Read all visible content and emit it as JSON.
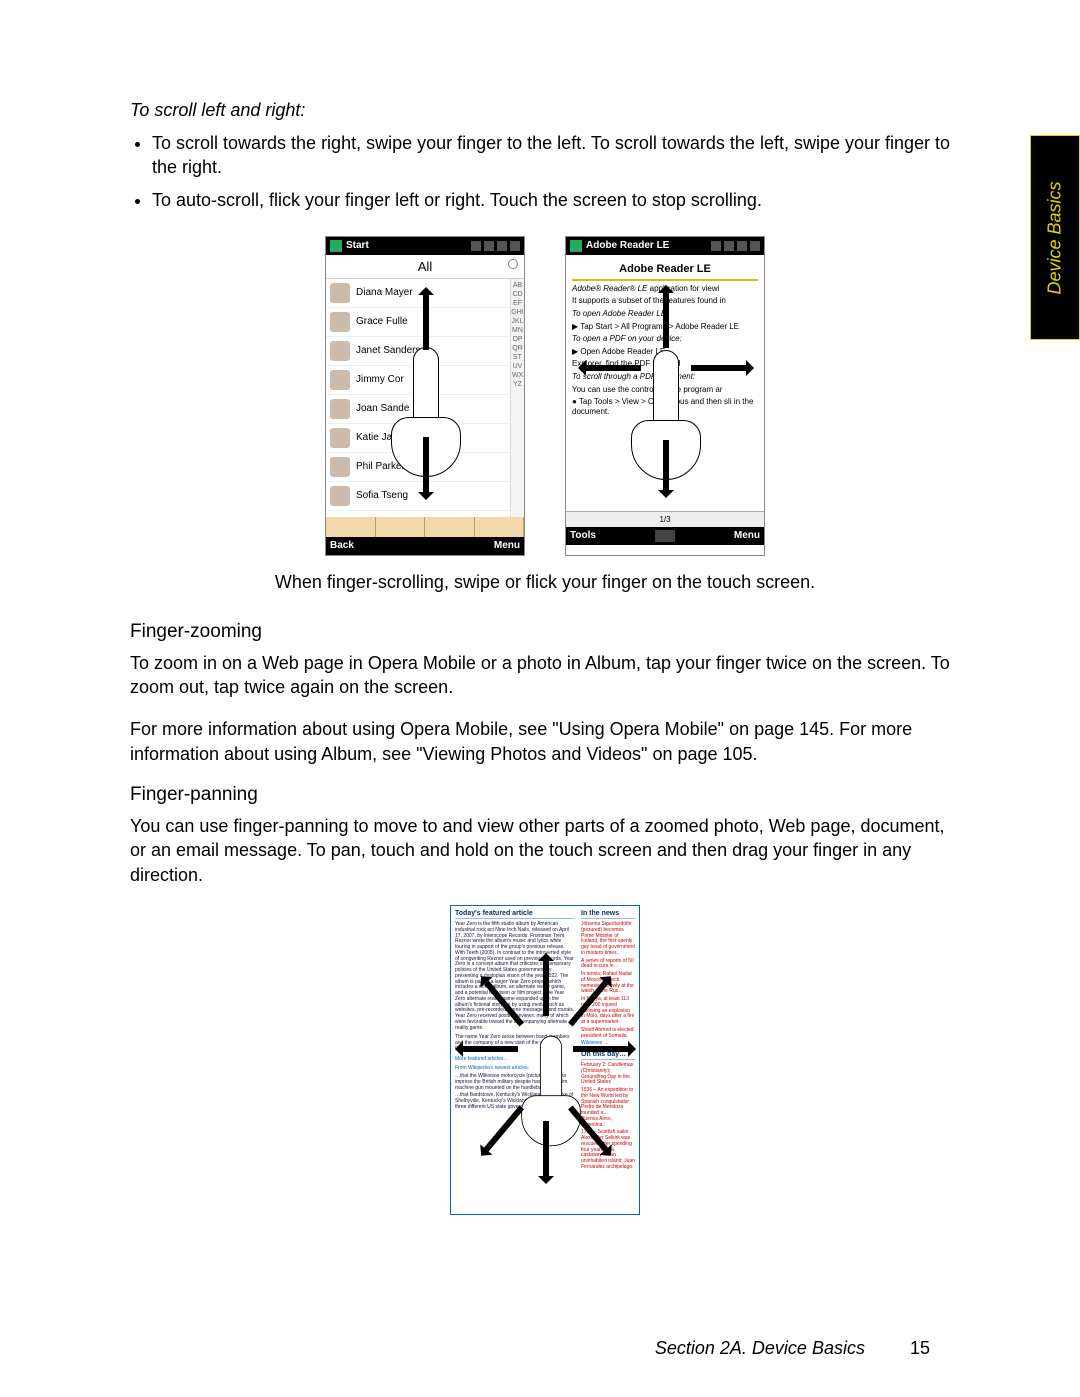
{
  "sideTab": "Device Basics",
  "scroll": {
    "heading": "To scroll left and right:",
    "bullets": [
      "To scroll towards the right, swipe your finger to the left. To scroll towards the left, swipe your finger to the right.",
      "To auto-scroll, flick your finger left or right. Touch the screen to stop scrolling."
    ],
    "caption": "When finger-scrolling, swipe or flick your finger on the touch screen."
  },
  "phone1": {
    "topbar": {
      "title": "Start"
    },
    "all": "All",
    "contacts": [
      "Diana Mayer",
      "Grace Fulle",
      "Janet Sanders",
      "Jimmy Cor",
      "Joan Sande",
      "Katie Jackson",
      "Phil Parker",
      "Sofia Tseng"
    ],
    "alphabet": "ABCDEFGHIJKLMNOPQRSTUVWXYZ",
    "bottom": {
      "left": "Back",
      "right": "Menu"
    }
  },
  "phone2": {
    "topbar": {
      "title": "Adobe Reader LE"
    },
    "docTitle": "Adobe Reader LE",
    "lines": {
      "l1a": "Adobe® Reader® LE",
      "l1b": " application for viewi",
      "l2": "It supports a subset of the features found in",
      "open1": "To open Adobe Reader LE:",
      "open1b": "▶ Tap Start > All Programs > Adobe Reader LE",
      "open2": "To open a PDF on your device:",
      "open2b": "▶ Open Adobe Reader LE.",
      "open2c": "Explorer, find the PDF file, and",
      "scroll1": "To scroll through a PDF document:",
      "scroll1b": "You can use the controls in the program ar",
      "scroll1c": "● Tap Tools > View > Continuous and then sli in the document."
    },
    "pager": "1/3",
    "bottom": {
      "left": "Tools",
      "right": "Menu"
    }
  },
  "zoom": {
    "heading": "Finger-zooming",
    "p1": "To zoom in on a Web page in Opera Mobile or a photo in Album, tap your finger twice on the screen. To zoom out, tap twice again on the screen.",
    "p2": "For more information about using Opera Mobile, see \"Using Opera Mobile\" on page 145. For more information about using Album, see \"Viewing Photos and Videos\" on page 105."
  },
  "pan": {
    "heading": "Finger-panning",
    "p1": "You can use finger-panning to move to and view other parts of a zoomed photo, Web page, document, or an email message. To pan, touch and hold on the touch screen and then drag your finger in any direction."
  },
  "panfig": {
    "left": {
      "h": "Today's featured article",
      "body1": "Year Zero is the fifth studio album by American industrial rock act Nine Inch Nails, released on April 17, 2007, by Interscope Records. Frontman Trent Reznor wrote the album's music and lyrics while touring in support of the group's previous release, With Teeth (2005). In contrast to the introverted style of songwriting Reznor used on previous records, Year Zero is a concept album that criticizes contemporary policies of the United States government by presenting a dystopian vision of the year 2022. The album is part of a larger Year Zero project which includes a remix album, an alternate reality game, and a potential television or film project. The Year Zero alternate reality game expanded upon the album's fictional storyline by using media such as websites, pre-recorded phone messages, and murals. Year Zero received positive reviews; many of which were favorable toward the accompanying alternate reality game.",
      "body2": "The name Year Zero arose between band members and the company of a new start of the album. Recently Music…",
      "more": "More featured articles…",
      "wiki": "From Wikipedia's newest articles:",
      "b1": "…that the Wilkinson motorcycle (pictured) failed to impress the British military despite having a Maxim machine gun mounted on the handlebars?",
      "b2": "…that Bardstown, Kentucky's Wickland, namesake of Shelbyville, Kentucky's Wickland, was the home of three different US state governors?"
    },
    "right": {
      "h": "In the news",
      "n1": "Jóhanna Sigurðardóttir (pictured) becomes Prime Minister of Iceland, the first openly gay head of government in modern times.",
      "n2": "A series of reports of 50 dead occurs in…",
      "n3": "In tennis, Rafael Nadal of Moscow's arch nemesis narrowly at the watch of the Rus…",
      "n4": "In Kenya, at least 113 over 200 injured following an explosion in Molo, days after a fire at a supermarket.",
      "n5": "Sharif Ahmed is elected president of Somalia.",
      "wiki": "Wikinews →",
      "day": "On this day…",
      "d1": "February 2: Candlemas (Christianity); Groundhog Day in the United States",
      "d2": "1536 – An expedition to the New World led by Spanish conquistador Pedro de Mendoza founded a…",
      "d3": "Buenos Aires, Argentina.",
      "d4": "1709 – Scottish sailor Alexander Selkirk was rescued after spending four years as a castaway on an uninhabited island; Juan Fernández archipelago."
    }
  },
  "footer": {
    "section": "Section 2A. Device Basics",
    "page": "15"
  }
}
